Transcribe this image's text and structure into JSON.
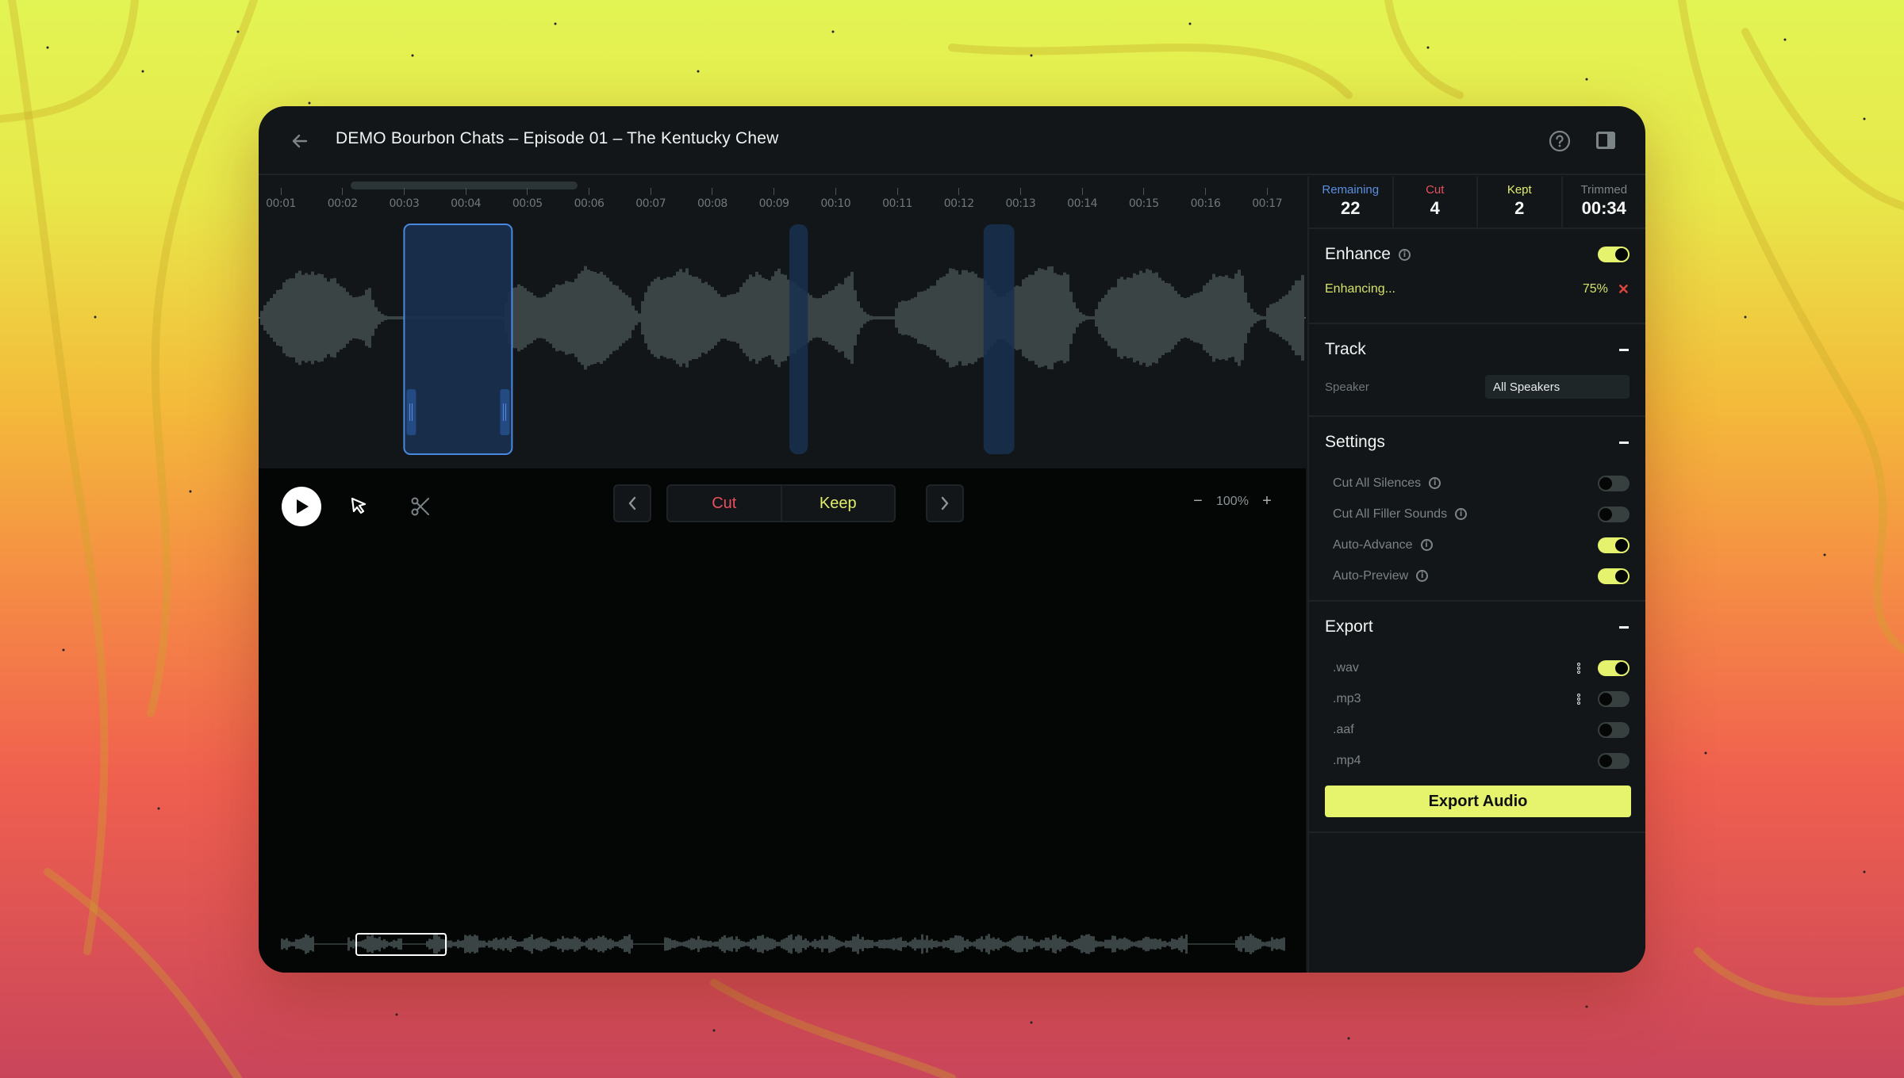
{
  "window": {
    "title": "DEMO Bourbon Chats – Episode 01 – The Kentucky Chew",
    "back_icon": "arrow-left-icon",
    "help_icon": "question-circle-icon",
    "panel_icon": "sidebar-panel-icon"
  },
  "timeline": {
    "ticks": [
      "00:01",
      "00:02",
      "00:03",
      "00:04",
      "00:05",
      "00:06",
      "00:07",
      "00:08",
      "00:09",
      "00:10",
      "00:11",
      "00:12",
      "00:13",
      "00:14",
      "00:15",
      "00:16",
      "00:17"
    ],
    "regions": [
      {
        "start_sec": 3.0,
        "end_sec": 4.75,
        "selected": true
      },
      {
        "start_sec": 9.25,
        "end_sec": 9.55,
        "selected": false
      },
      {
        "start_sec": 12.4,
        "end_sec": 12.9,
        "selected": false
      }
    ],
    "colors": {
      "waveform": "#3a4444",
      "region": "#19304f",
      "region_border": "#4a88e0"
    }
  },
  "toolbar": {
    "play_icon": "play-icon",
    "select_icon": "cursor-arrow-icon",
    "scissors_icon": "scissors-icon",
    "prev_icon": "chevron-left-icon",
    "next_icon": "chevron-right-icon",
    "cut_label": "Cut",
    "keep_label": "Keep",
    "zoom_out": "−",
    "zoom_level": "100%",
    "zoom_in": "+"
  },
  "stats": [
    {
      "label": "Remaining",
      "value": "22",
      "color": "#5b8fe0"
    },
    {
      "label": "Cut",
      "value": "4",
      "color": "#e5515f"
    },
    {
      "label": "Kept",
      "value": "2",
      "color": "#e2ee6b"
    },
    {
      "label": "Trimmed",
      "value": "00:34",
      "color": "#7b8385"
    }
  ],
  "enhance": {
    "title": "Enhance",
    "enabled": true,
    "status": "Enhancing...",
    "progress": "75%",
    "cancel_icon": "close-x-icon"
  },
  "track": {
    "title": "Track",
    "speaker_label": "Speaker",
    "speaker_value": "All Speakers"
  },
  "settings": {
    "title": "Settings",
    "items": [
      {
        "label": "Cut All Silences",
        "on": false
      },
      {
        "label": "Cut All Filler Sounds",
        "on": false
      },
      {
        "label": "Auto-Advance",
        "on": true
      },
      {
        "label": "Auto-Preview",
        "on": true
      }
    ]
  },
  "export": {
    "title": "Export",
    "formats": [
      {
        "label": ".wav",
        "on": true,
        "has_menu": true
      },
      {
        "label": ".mp3",
        "on": false,
        "has_menu": true
      },
      {
        "label": ".aaf",
        "on": false,
        "has_menu": false
      },
      {
        "label": ".mp4",
        "on": false,
        "has_menu": false
      }
    ],
    "button_label": "Export Audio"
  },
  "colors": {
    "accent": "#e6f36c",
    "cut": "#e5515f",
    "remaining": "#5b8fe0"
  }
}
